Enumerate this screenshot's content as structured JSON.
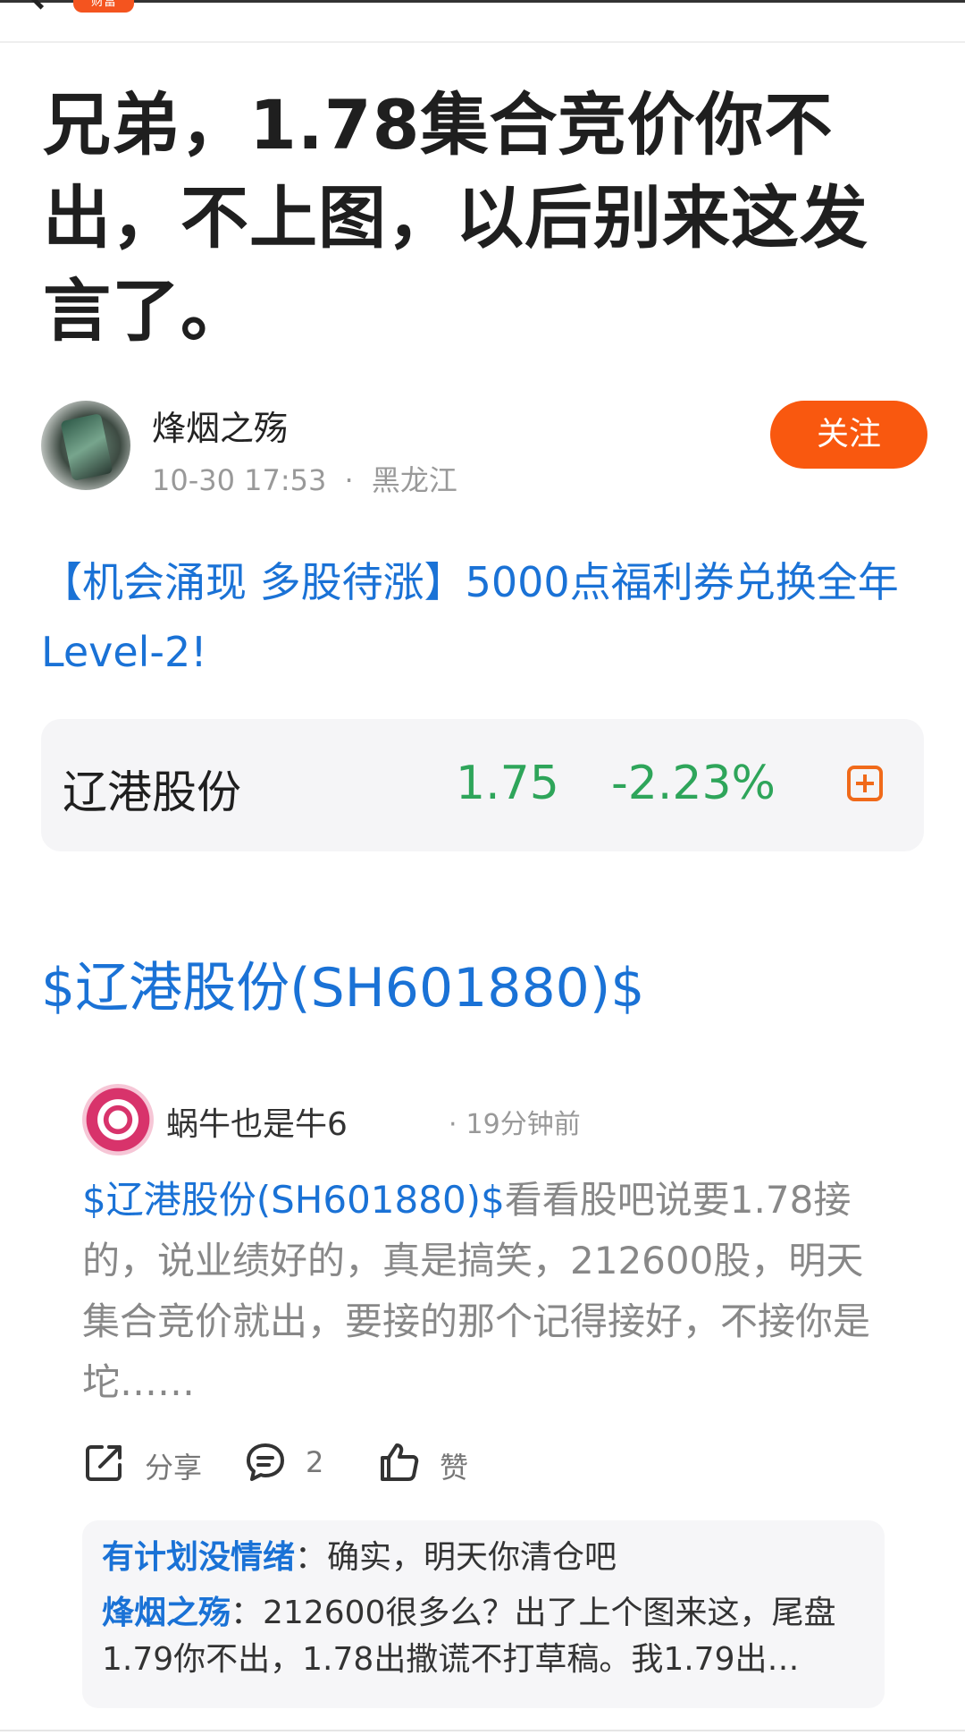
{
  "nav": {
    "badge": "财富"
  },
  "post": {
    "title": "兄弟，1.78集合竞价你不出，不上图，以后别来这发言了。",
    "author": {
      "name": "烽烟之殇",
      "time": "10-30 17:53",
      "location": "黑龙江",
      "separator": "·"
    },
    "follow_label": "关注",
    "promo_text": "【机会涌现 多股待涨】5000点福利券兑换全年Level-2!",
    "tag_heading": "$辽港股份(SH601880)$"
  },
  "stock": {
    "name": "辽港股份",
    "price": "1.75",
    "change": "-2.23%",
    "color": "#2ea55a"
  },
  "quoted": {
    "author": "蜗牛也是牛6",
    "separator": "·",
    "time": "19分钟前",
    "link_text": "$辽港股份(SH601880)$",
    "body": "看看股吧说要1.78接的，说业绩好的，真是搞笑，212600股，明天集合竞价就出，要接的那个记得接好，不接你是坨……",
    "actions": {
      "share_label": "分享",
      "comment_count": "2",
      "like_label": "赞"
    }
  },
  "replies": [
    {
      "user": "有计划没情绪",
      "text": "：确实，明天你清仓吧"
    },
    {
      "user": "烽烟之殇",
      "text": "：212600很多么？出了上个图来这，尾盘1.79你不出，1.78出撒谎不打草稿。我1.79出…"
    }
  ],
  "colors": {
    "accent_blue": "#1a72d6",
    "follow_orange": "#f9580f",
    "down_green": "#2ea55a"
  }
}
